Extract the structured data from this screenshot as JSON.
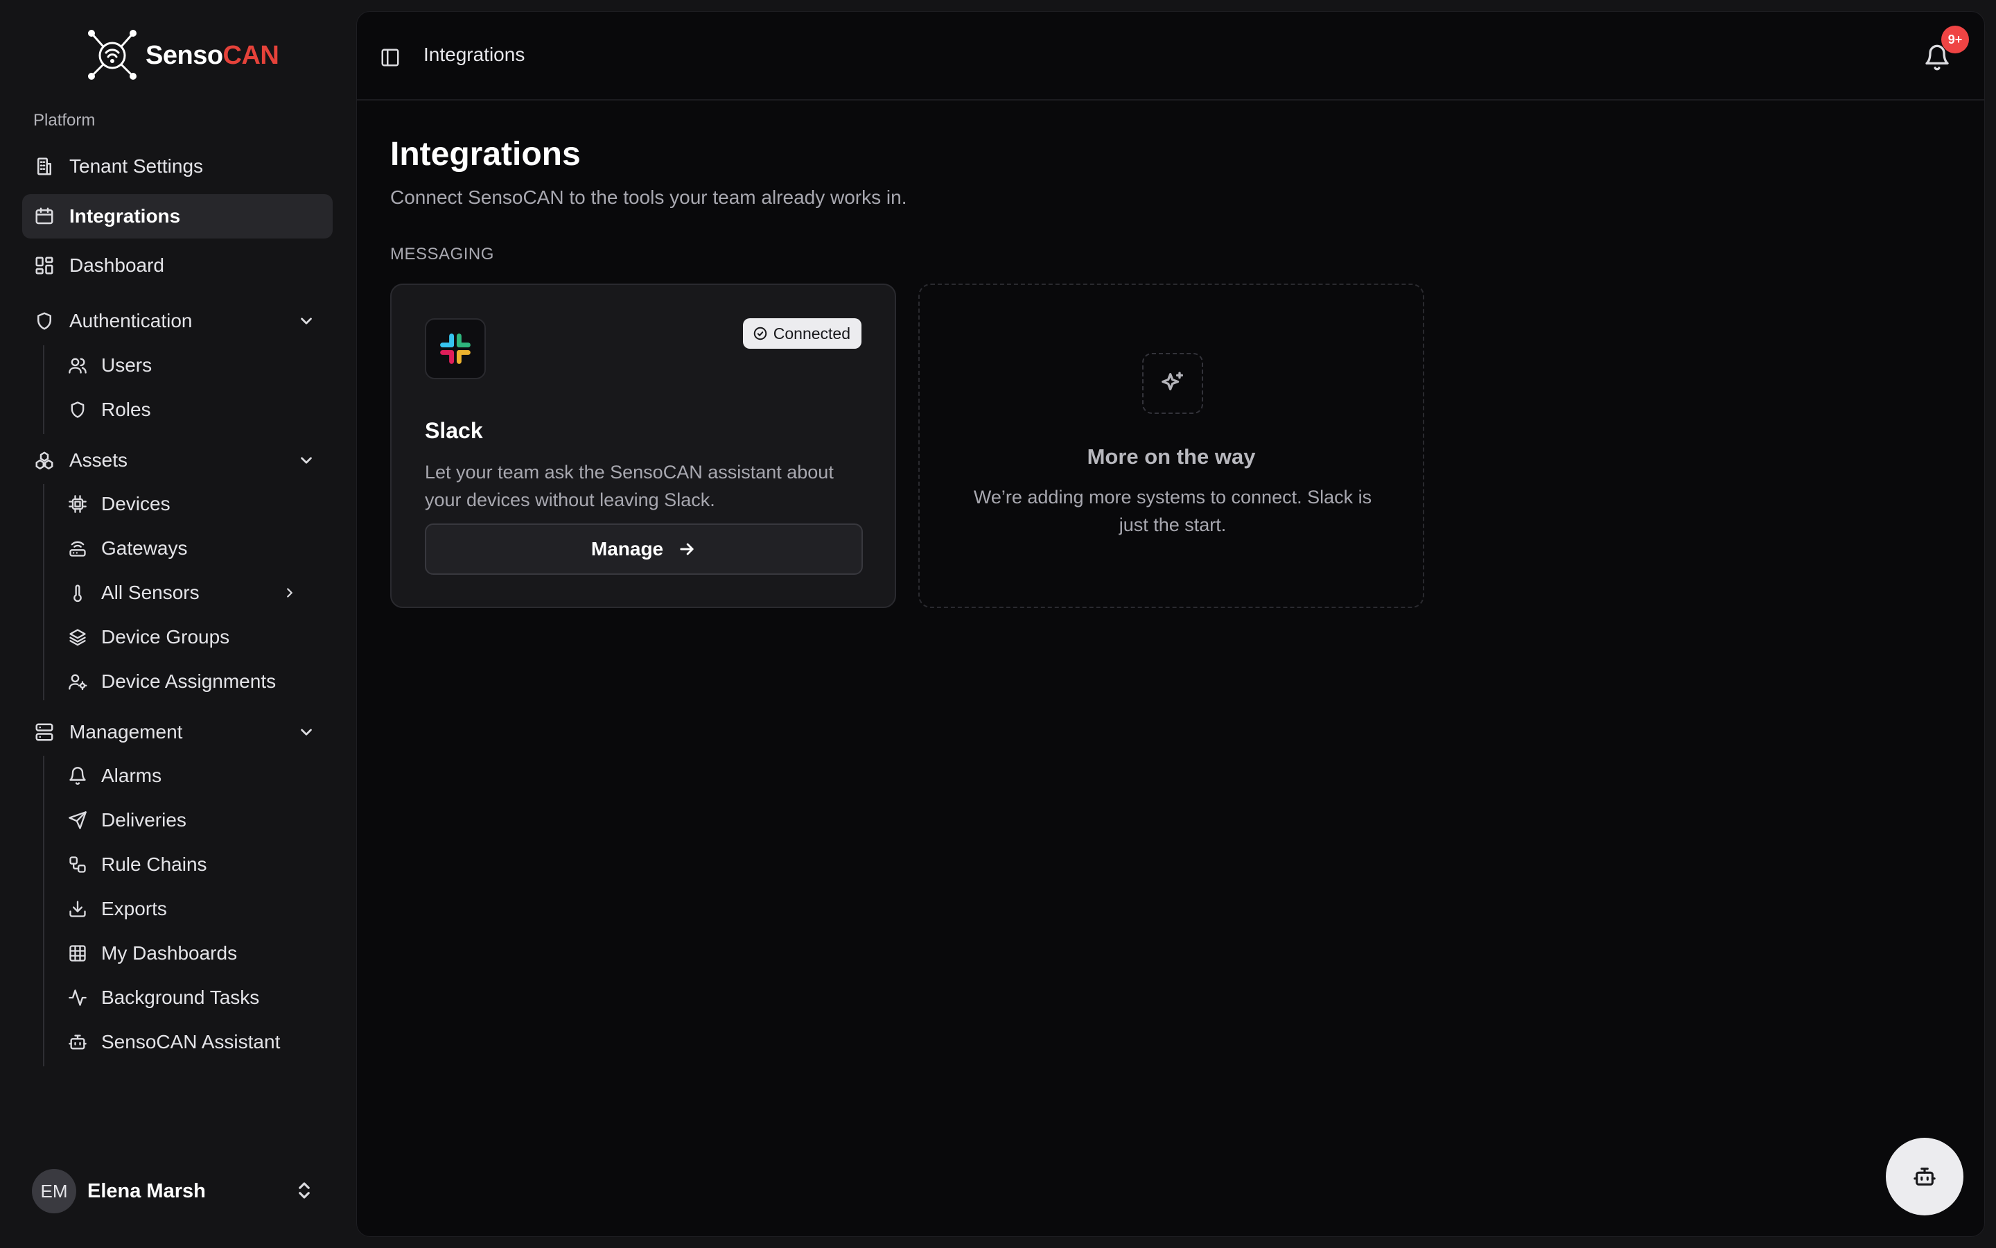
{
  "brand": {
    "name_part1": "Senso",
    "name_part2": "CAN",
    "accent": "#e5423a"
  },
  "sidebar": {
    "group_label": "Platform",
    "items": {
      "tenant_settings": "Tenant Settings",
      "integrations": "Integrations",
      "dashboard": "Dashboard",
      "authentication": "Authentication",
      "users": "Users",
      "roles": "Roles",
      "assets": "Assets",
      "devices": "Devices",
      "gateways": "Gateways",
      "all_sensors": "All Sensors",
      "device_groups": "Device Groups",
      "device_assignments": "Device Assignments",
      "management": "Management",
      "alarms": "Alarms",
      "deliveries": "Deliveries",
      "rule_chains": "Rule Chains",
      "exports": "Exports",
      "my_dashboards": "My Dashboards",
      "background_tasks": "Background Tasks",
      "assistant": "SensoCAN Assistant"
    },
    "user": {
      "initials": "EM",
      "name": "Elena Marsh"
    }
  },
  "header": {
    "breadcrumb": "Integrations",
    "notification_badge": "9+"
  },
  "page": {
    "title": "Integrations",
    "subtitle": "Connect SensoCAN to the tools your team already works in.",
    "section_label": "MESSAGING"
  },
  "cards": {
    "slack": {
      "status": "Connected",
      "title": "Slack",
      "description": "Let your team ask the SensoCAN assistant about your devices without leaving Slack.",
      "button_label": "Manage"
    },
    "coming_soon": {
      "title": "More on the way",
      "description": "We’re adding more systems to connect. Slack is just the start."
    }
  },
  "colors": {
    "badge": "#ef4444",
    "panel": "#09090b",
    "sidebar": "#141416"
  }
}
